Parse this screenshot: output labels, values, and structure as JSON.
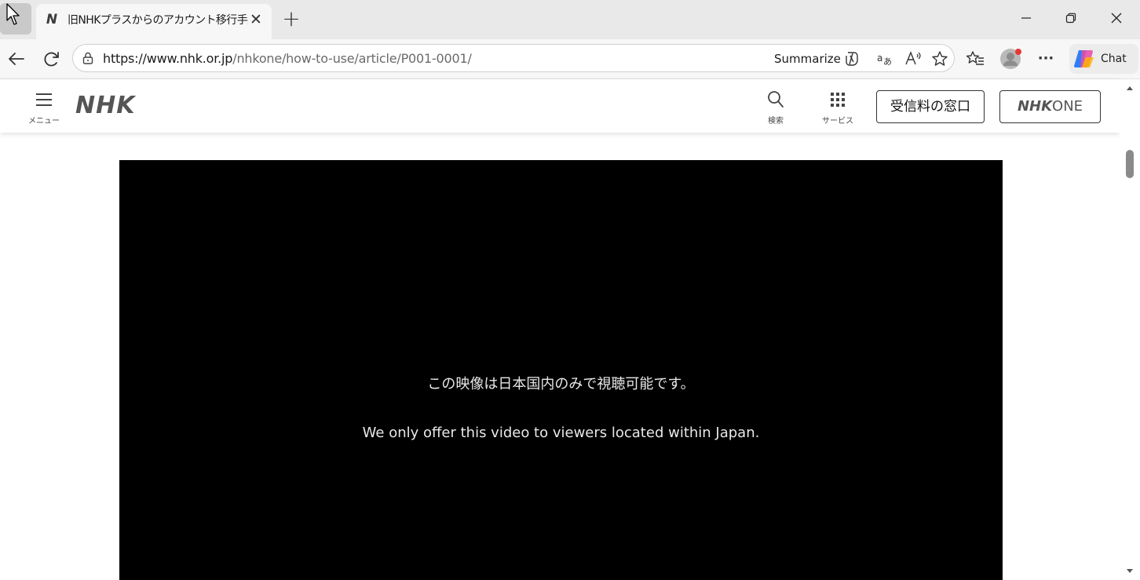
{
  "tab": {
    "favicon": "N",
    "title": "旧NHKプラスからのアカウント移行手続",
    "close": "✕"
  },
  "new_tab": "+",
  "window": {
    "minimize": "─",
    "restore": "❐",
    "close": "✕"
  },
  "address": {
    "url_host": "https://www.nhk.or.jp",
    "url_path": "/nhkone/how-to-use/article/P001-0001/",
    "summarize_label": "Summarize"
  },
  "toolbar_extra": {
    "more": "···",
    "chat_label": "Chat"
  },
  "header": {
    "menu_label": "メニュー",
    "logo_text": "NHK",
    "search_label": "検索",
    "services_label": "サービス",
    "fee_button": "受信料の窓口",
    "nhkone_logo": "NHK",
    "nhkone_suffix": "ONE"
  },
  "video": {
    "message_ja": "この映像は日本国内のみで視聴可能です。",
    "message_en": "We only offer this video to viewers located within Japan."
  },
  "colors": {
    "tabstrip": "#e9e9e9",
    "toolbar": "#f7f7f7",
    "video_bg": "#000000",
    "profile_badge": "#e53935"
  }
}
